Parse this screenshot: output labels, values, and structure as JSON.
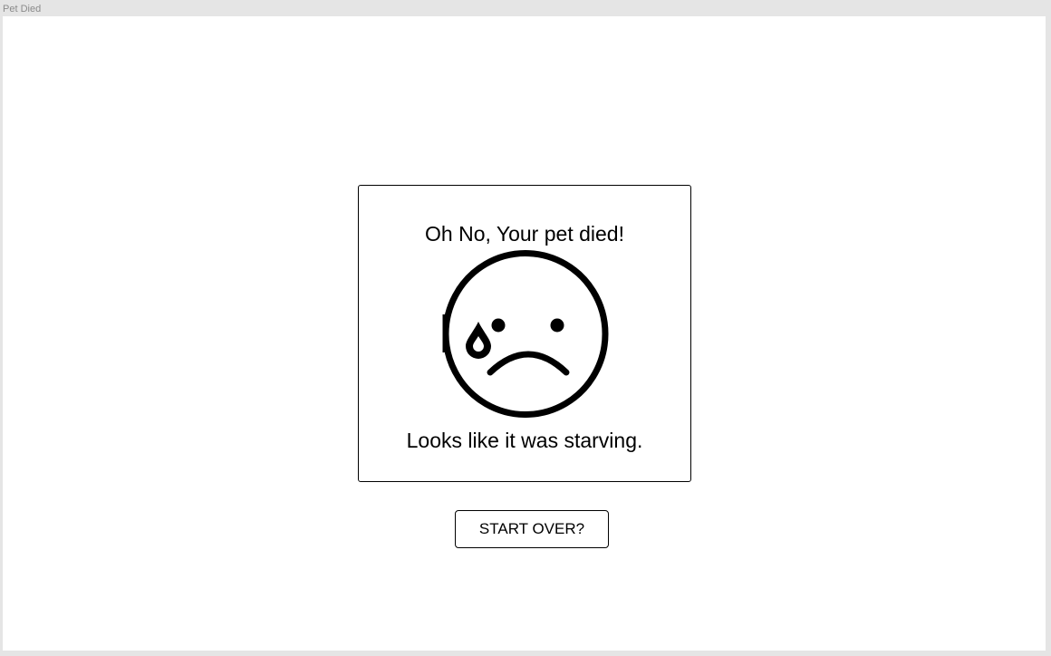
{
  "frame": {
    "label": "Pet Died"
  },
  "dialog": {
    "title": "Oh No, Your pet died!",
    "message": "Looks like it was starving.",
    "icon": "sad-crying-face-icon"
  },
  "actions": {
    "start_over_label": "START OVER?"
  }
}
